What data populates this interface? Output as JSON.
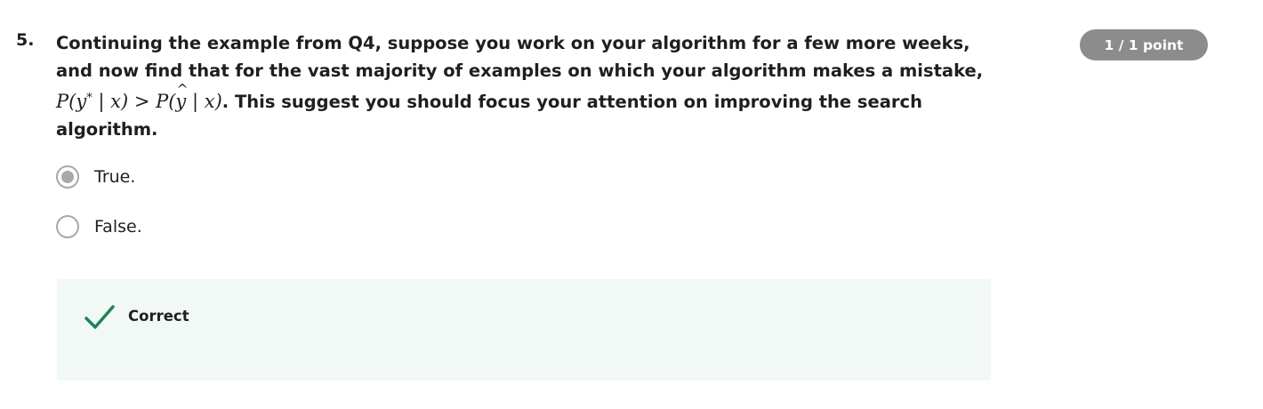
{
  "question": {
    "number": "5.",
    "text_line1": "Continuing the example from Q4, suppose you work on your algorithm for a few more weeks, and now find that for the vast majority of examples on which your algorithm makes a mistake,",
    "math": {
      "p1": "P(y",
      "star": "*",
      "cond1": " | x) > P(",
      "yhat": "y",
      "cond2": " | x)"
    },
    "text_line2": ". This suggest you should focus your attention on improving the search algorithm."
  },
  "score_badge": "1 / 1 point",
  "options": [
    {
      "label": "True.",
      "selected": true
    },
    {
      "label": "False.",
      "selected": false
    }
  ],
  "feedback": {
    "label": "Correct",
    "icon": "checkmark-icon",
    "color": "#1f8354"
  },
  "colors": {
    "badge_bg": "#8c8c8c",
    "feedback_bg": "#f2f8f6",
    "radio": "#a8a8a8"
  }
}
